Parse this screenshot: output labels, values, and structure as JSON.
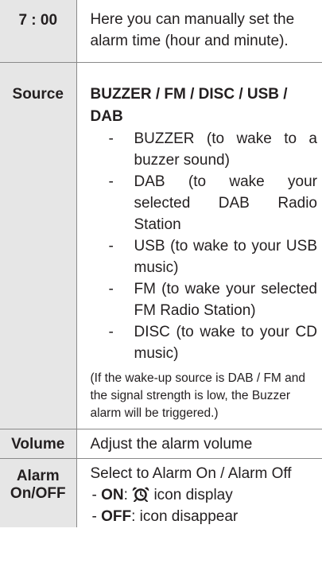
{
  "rows": [
    {
      "key": "7 : 00",
      "text": "Here you can manually set the alarm time (hour and minute)."
    },
    {
      "key": "Source",
      "heading": "BUZZER / FM / DISC / USB / DAB",
      "dash": "-",
      "options": [
        "BUZZER (to wake to a buzzer sound)",
        "DAB (to wake your selected DAB Radio Station",
        "USB (to wake to your USB music)",
        "FM (to wake your selected FM Radio Station)",
        "DISC (to wake to your CD music)"
      ],
      "note": "(If the wake-up source is DAB / FM and the signal strength is low, the Buzzer alarm will be triggered.)"
    },
    {
      "key": "Volume",
      "text": "Adjust the alarm volume"
    },
    {
      "key_line1": "Alarm",
      "key_line2": "On/OFF",
      "text": "Select to Alarm On / Alarm Off",
      "on_label": "ON",
      "on_text": ": ",
      "on_suffix": " icon display",
      "off_label": "OFF",
      "off_text": ": icon disappear",
      "bullet": "- ",
      "icon": "alarm-clock-icon"
    }
  ]
}
